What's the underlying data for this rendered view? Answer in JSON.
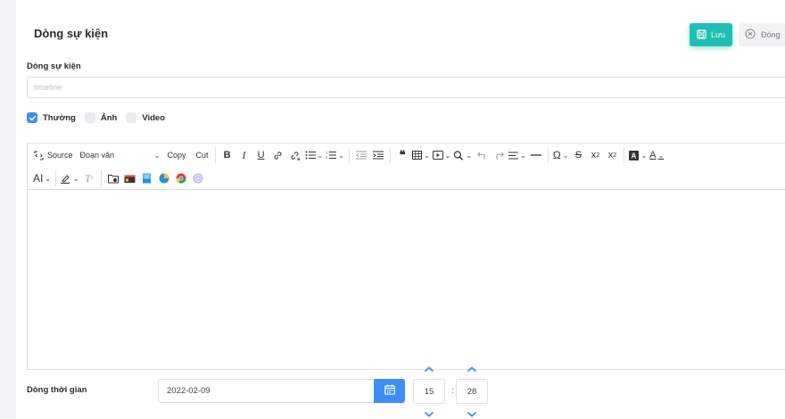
{
  "header": {
    "title": "Dòng sự kiện",
    "save_label": "Lưu",
    "close_label": "Đóng"
  },
  "event_field": {
    "label": "Dòng sự kiện",
    "placeholder": "timeline",
    "value": ""
  },
  "post_types": [
    {
      "label": "Thường",
      "checked": true
    },
    {
      "label": "Ảnh",
      "checked": false
    },
    {
      "label": "Video",
      "checked": false
    }
  ],
  "toolbar": {
    "source_label": "Source",
    "heading_label": "Đoạn văn",
    "copy_label": "Copy",
    "cut_label": "Cut",
    "ai_label": "AI"
  },
  "time_field": {
    "label": "Dòng thời gian",
    "date": "2022-02-09",
    "hour": "15",
    "minute": "28"
  },
  "colors": {
    "accent_teal": "#1fc0b4",
    "accent_blue": "#3d8ef6"
  }
}
